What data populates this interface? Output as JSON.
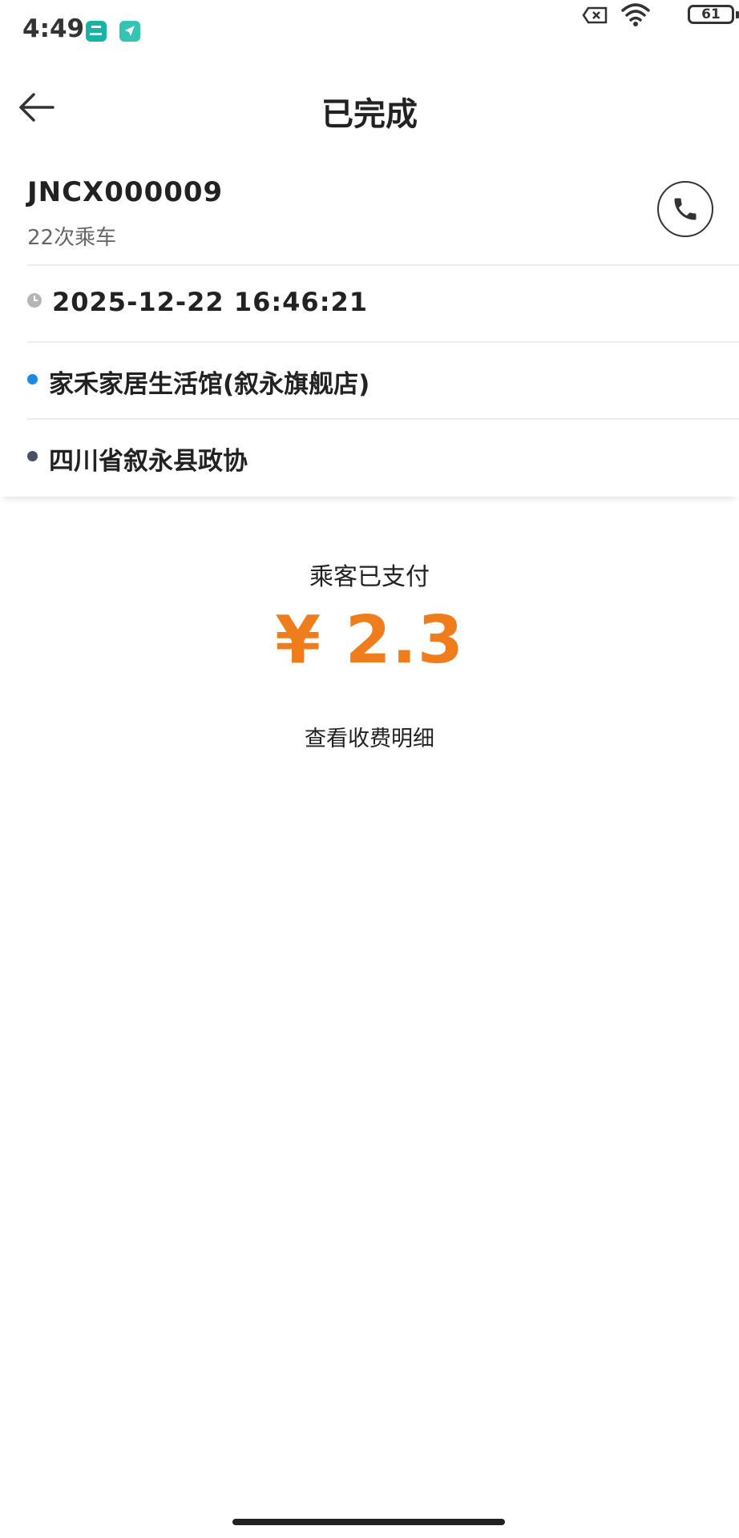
{
  "status_bar": {
    "time": "4:49",
    "battery_level": "61",
    "icons": [
      "app-notification-icon",
      "navigation-app-icon",
      "sim-error-icon",
      "wifi-icon",
      "battery-icon"
    ]
  },
  "nav": {
    "title": "已完成",
    "back_icon": "arrow-left-icon"
  },
  "passenger": {
    "id": "JNCX000009",
    "ride_count": "22次乘车",
    "call_icon": "phone-icon"
  },
  "trip": {
    "time": "2025-12-22 16:46:21",
    "from": "家禾家居生活馆(叙永旗舰店)",
    "to": "四川省叙永县政协"
  },
  "payment": {
    "status": "乘客已支付",
    "amount": "¥ 2.3",
    "detail_link": "查看收费明细"
  },
  "colors": {
    "accent": "#f07d1c",
    "start_dot": "#1e88e5",
    "end_dot": "#4a4f66"
  }
}
